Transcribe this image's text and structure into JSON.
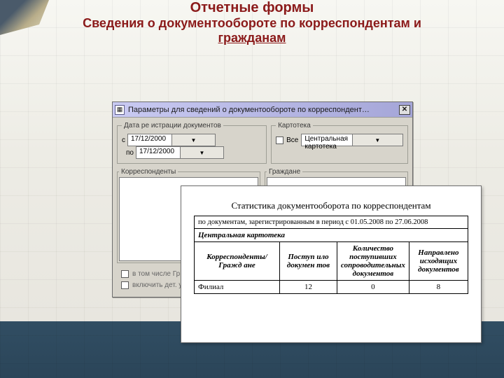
{
  "page": {
    "title_line1": "Отчетные формы",
    "title_line2": "Сведения о документообороте по корреспондентам и",
    "title_line3": "гражданам"
  },
  "dialog": {
    "title": "Параметры для сведений о документообороте по корреспондент…",
    "close_glyph": "✕",
    "groups": {
      "reg_dates": {
        "legend": "Дата ре истрации документов",
        "from_label": "с",
        "to_label": "по",
        "from_value": "17/12/2000",
        "to_value": "17/12/2000"
      },
      "karto": {
        "legend": "Картотека",
        "all_label": "Все",
        "selected": "Центральная картотека"
      },
      "korres": {
        "legend": "Корреспонденты"
      },
      "grazh": {
        "legend": "Граждане"
      }
    },
    "lower_checks": {
      "c1": "в том числе Гр…",
      "c2": "включить дет. у…"
    }
  },
  "report": {
    "title": "Статистика документооборота по корреспондентам",
    "period_text": "по документам, зарегистрированным в период с 01.05.2008 по 27.06.2008",
    "kartoteka": "Центральная картотека",
    "columns": {
      "c0": "Корреспонденты/Гражд\nане",
      "c1": "Поступ\nило\nдокумен\nтов",
      "c2": "Количество\nпоступивших\nсопроводительных\nдокументов",
      "c3": "Направлено\nисходящих\nдокументов"
    },
    "rows": [
      {
        "name": "Филиал",
        "in_docs": 12,
        "in_accomp": 0,
        "out_docs": 8
      }
    ]
  }
}
